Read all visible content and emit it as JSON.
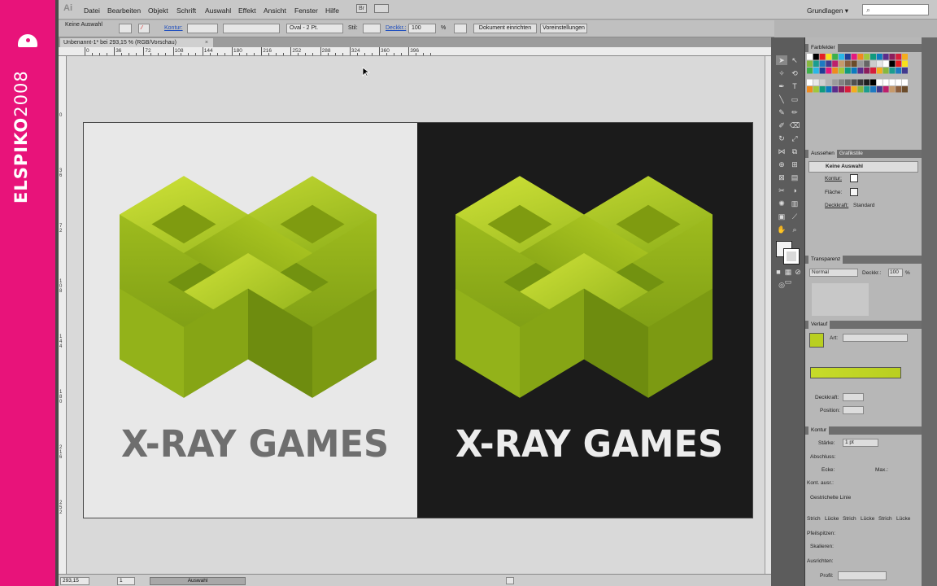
{
  "watermark": {
    "brand_bold": "ELSPIKO",
    "brand_num": "2008",
    "color": "#e8137a"
  },
  "app": {
    "logo": "Ai",
    "workspace": "Grundlagen ▾",
    "search_icon": "search-icon"
  },
  "menu": [
    "Datei",
    "Bearbeiten",
    "Objekt",
    "Schrift",
    "Auswahl",
    "Effekt",
    "Ansicht",
    "Fenster",
    "Hilfe"
  ],
  "menu_extras": {
    "bridge": "Br"
  },
  "control": {
    "selection": "Keine Auswahl",
    "stroke_label": "Kontur:",
    "brush_value": "Oval - 2 Pt.",
    "style_label": "Stil:",
    "opacity_label": "Deckkr.:",
    "opacity_value": "100",
    "opacity_unit": "%",
    "doc_setup": "Dokument einrichten",
    "preferences": "Voreinstellungen"
  },
  "doc_tab": {
    "title": "Unbenannt-1* bei 293,15 % (RGB/Vorschau)",
    "close": "×"
  },
  "hruler": [
    "0",
    "36",
    "72",
    "108",
    "144",
    "180",
    "216",
    "252",
    "288",
    "324",
    "360",
    "396"
  ],
  "vruler": [
    "0",
    "3 6",
    "7 2",
    "1 0 8",
    "1 4 4",
    "1 8 0",
    "2 1 6",
    "2 5 2"
  ],
  "status": {
    "zoom": "293,15",
    "page": "1",
    "tool": "Auswahl"
  },
  "artwork": {
    "title": "X-RAY GAMES",
    "light_text_color": "#6e6e6e",
    "dark_text_color": "#ececec",
    "green_light": "#c7db2a",
    "green_dark": "#6f8f10"
  },
  "panels": {
    "swatches": "Farbfelder",
    "appearance": "Aussehen",
    "graphic_styles": "Grafikstile",
    "no_selection": "Keine Auswahl",
    "stroke": "Kontur:",
    "fill": "Fläche:",
    "opacity": "Deckkraft:",
    "opacity_val": "Standard",
    "transparency": "Transparenz",
    "blend_mode": "Normal",
    "t_opacity": "Deckkr.:",
    "t_opacity_val": "100",
    "t_unit": "%",
    "gradient": "Verlauf",
    "grad_type": "Art:",
    "grad_opacity": "Deckkraft:",
    "grad_position": "Position:",
    "stroke_panel": "Kontur",
    "weight": "Stärke:",
    "weight_val": "1 pt",
    "cap": "Abschluss:",
    "corner": "Ecke:",
    "limit": "Max.:",
    "align": "Kont. ausr.:",
    "dashed": "Gestrichelte Linie",
    "dash_labels": [
      "Strich",
      "Lücke",
      "Strich",
      "Lücke",
      "Strich",
      "Lücke"
    ],
    "arrowheads": "Pfeilspitzen:",
    "scale": "Skalieren:",
    "align_arrows": "Ausrichten:",
    "profile": "Profil:"
  }
}
